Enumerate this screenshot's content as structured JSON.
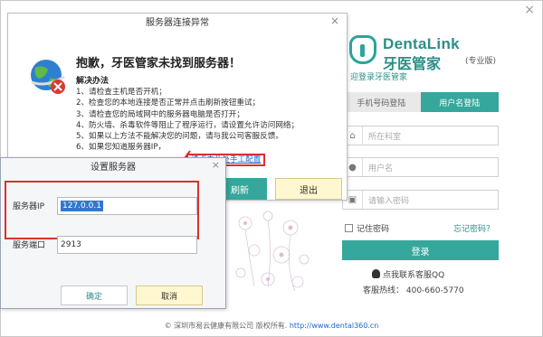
{
  "login": {
    "brand_en": "DentaLink",
    "brand_cn": "牙医管家",
    "edition": "(专业版)",
    "welcome": "迎登录牙医管家",
    "tabs": [
      {
        "label": "手机号码登陆"
      },
      {
        "label": "用户名登陆"
      }
    ],
    "fields": [
      {
        "placeholder": "所在科室"
      },
      {
        "placeholder": "用户名"
      },
      {
        "placeholder": "请输入密码"
      }
    ],
    "remember_label": "记住密码",
    "forgot_label": "忘记密码？",
    "login_button": "登录",
    "contact_qq": "点我联系客服QQ",
    "hotline": "客服热线：  400-660-5770",
    "close_symbol": "×",
    "footer_prefix": "© 深圳市易云健康有限公司 版权所有.",
    "footer_link": "http://www.dental360.cn"
  },
  "error_dialog": {
    "title": "服务器连接异常",
    "heading": "抱歉，牙医管家未找到服务器！",
    "subheading": "解决办法",
    "steps": [
      "1、请检查主机是否开机；",
      "2、检查您的本地连接是否正常并点击刷新按钮重试；",
      "3、请检查您的局域网中的服务器电脑是否打开；",
      "4、防火墙、杀毒软件等阻止了程序运行，请设置允许访问网络；",
      "5、如果以上方法不能解决您的问题，请与我公司客服反馈。",
      "6、如果您知道服务器IP，"
    ],
    "manual_link": "请点击此处手工配置",
    "refresh_button": "刷新",
    "exit_button": "退出",
    "close_symbol": "×"
  },
  "settings_dialog": {
    "title": "设置服务器",
    "ip_label": "服务器IP",
    "ip_value": "127.0.0.1",
    "port_label": "服务端口",
    "port_value": "2913",
    "ok_button": "确定",
    "cancel_button": "取消",
    "close_symbol": "×"
  },
  "colors": {
    "accent": "#35a79c",
    "highlight": "#d9302f",
    "link": "#1a66cc"
  }
}
